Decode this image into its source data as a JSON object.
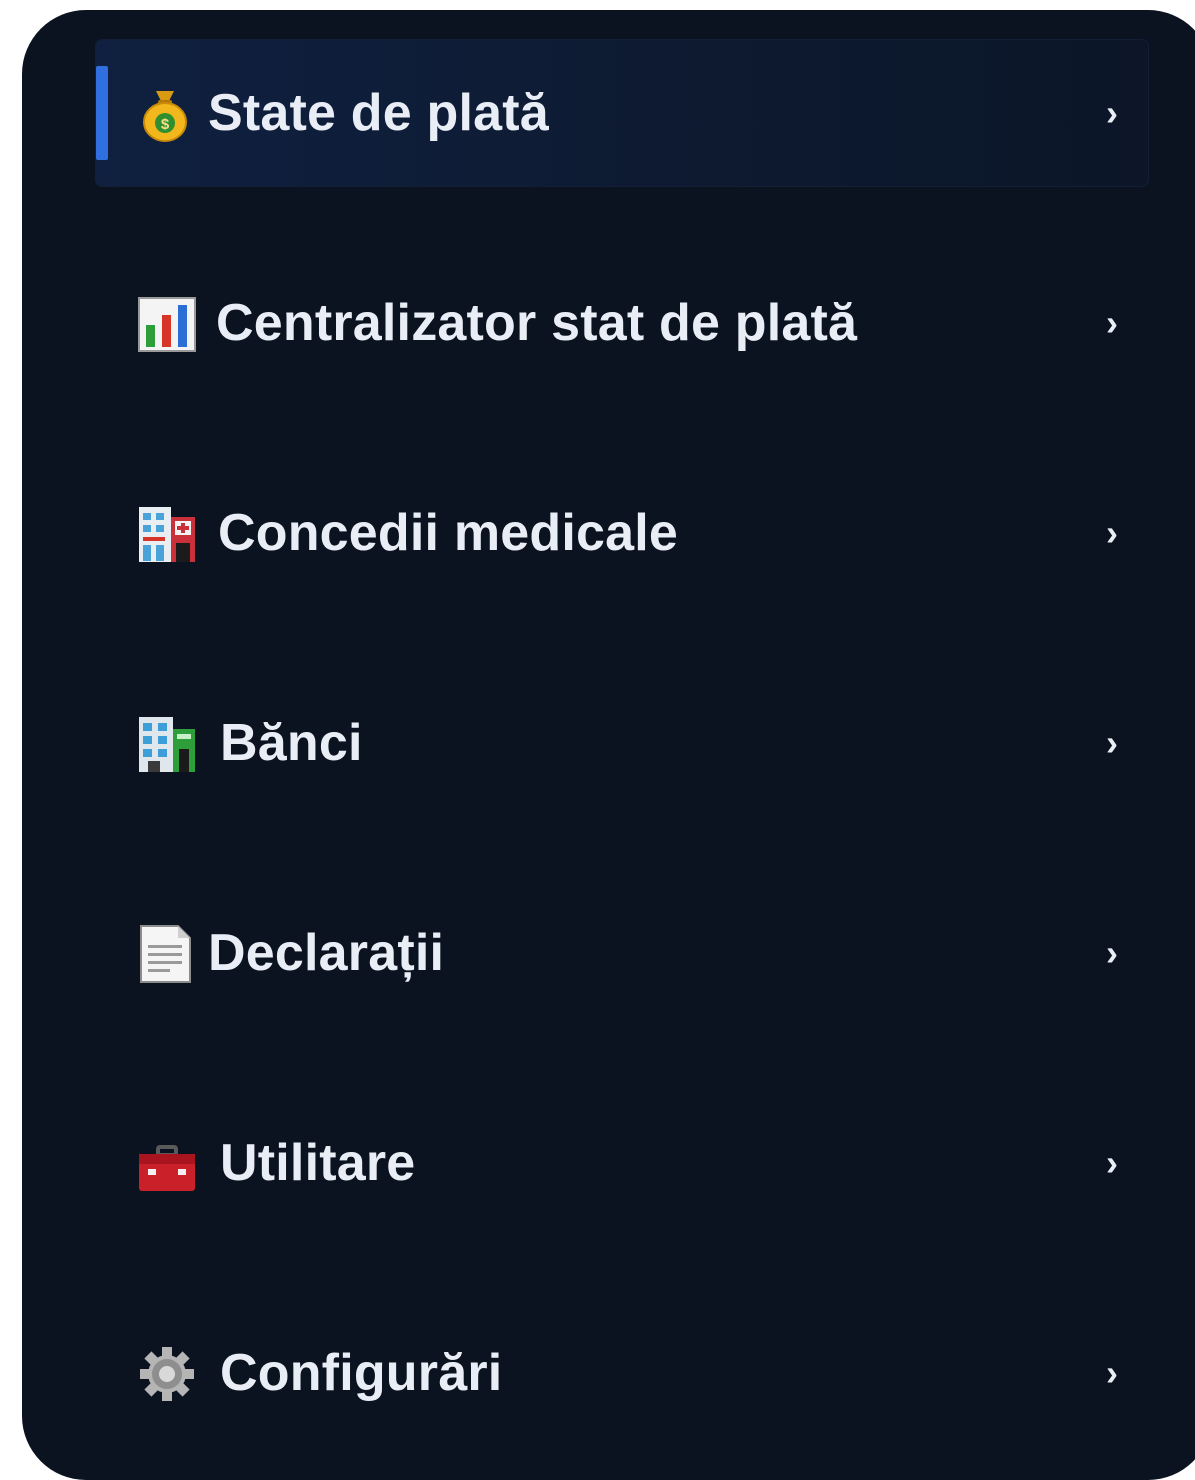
{
  "menu": {
    "items": [
      {
        "label": "State de plată",
        "icon": "money-bag-icon",
        "chevron": "›",
        "active": true
      },
      {
        "label": "Centralizator stat de plată",
        "icon": "bar-chart-icon",
        "chevron": "›",
        "active": false
      },
      {
        "label": "Concedii medicale",
        "icon": "hospital-icon",
        "chevron": "›",
        "active": false
      },
      {
        "label": "Bănci",
        "icon": "bank-building-icon",
        "chevron": "›",
        "active": false
      },
      {
        "label": "Declarații",
        "icon": "document-icon",
        "chevron": "›",
        "active": false
      },
      {
        "label": "Utilitare",
        "icon": "toolbox-icon",
        "chevron": "›",
        "active": false
      },
      {
        "label": "Configurări",
        "icon": "gear-icon",
        "chevron": "›",
        "active": false
      }
    ]
  },
  "colors": {
    "background": "#0b1220",
    "active_indicator": "#2f6fe0",
    "text": "#e9edf5"
  }
}
